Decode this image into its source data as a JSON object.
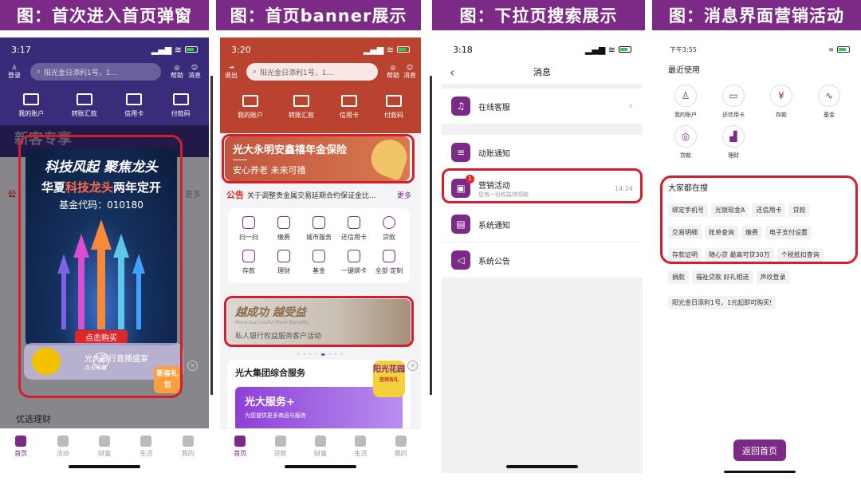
{
  "captions": [
    "图：首次进入首页弹窗",
    "图：首页banner展示",
    "图：下拉页搜索展示",
    "图：消息界面营销活动"
  ],
  "colors": {
    "brand": "#7b2a86",
    "highlight": "#d51e2b",
    "banner_red": "#c0392b"
  },
  "p1": {
    "time": "3:17",
    "search_placeholder": "阳光金日添利1号，1...",
    "left_icon_label": "登录",
    "right_labels": [
      "帮助",
      "消息"
    ],
    "quick": [
      "我的账户",
      "转账汇款",
      "信用卡",
      "付款码"
    ],
    "bg_title": "新客专享",
    "notice_short": "公",
    "more": "更多",
    "popup": {
      "line1": "科技风起 聚焦龙头",
      "line2a": "华夏",
      "line2b": "科技龙头",
      "line2c": "两年定开",
      "line3": "基金代码：010180",
      "button": "点击购买"
    },
    "bottom_banner": "光大银行直播盛宴",
    "bottom_sub": "点击观看",
    "side_badge": "新客礼包",
    "section": "优选理财",
    "tabs": [
      "首页",
      "活动",
      "财富",
      "生活",
      "我的"
    ]
  },
  "p2": {
    "time": "3:20",
    "left_label": "退出",
    "search_placeholder": "阳光金日添利1号，1...",
    "right_labels": [
      "帮助",
      "消息"
    ],
    "quick": [
      "我的账户",
      "转账汇款",
      "信用卡",
      "付款码"
    ],
    "banner": {
      "title": "光大永明安鑫禧年金保险",
      "sub": "安心养老 未来可禧"
    },
    "notice_tag": "公告",
    "notice": "关于调整贵金属交易延期合约保证金比...",
    "more": "更多",
    "grid": [
      "扫一扫",
      "缴费",
      "城市服务",
      "还信用卡",
      "贷款",
      "存款",
      "理财",
      "基金",
      "一键绑卡",
      "全部·定制"
    ],
    "banner2": {
      "title": "越成功 越受益",
      "en": "More Successful More Benefits",
      "sub": "私人银行权益服务客户活动"
    },
    "card_title": "光大集团综合服务",
    "card_inner": "光大服务+",
    "card_inner_sub": "为您提供更多商品与服务",
    "badge": "阳光花园",
    "badge_sub": "签到有礼",
    "tabs": [
      "首页",
      "贷款",
      "财富",
      "生活",
      "我的"
    ]
  },
  "p3": {
    "time": "3:18",
    "title": "消息",
    "rows": [
      {
        "icon": "headset-icon",
        "label": "在线客服",
        "arrow": "›"
      },
      {
        "icon": "bell-icon",
        "label": "动账通知"
      },
      {
        "icon": "gift-icon",
        "label": "营销活动",
        "sub": "您有一份权益待领取",
        "time": "14:24",
        "badge": "1"
      },
      {
        "icon": "doc-icon",
        "label": "系统通知"
      },
      {
        "icon": "speaker-icon",
        "label": "系统公告"
      }
    ]
  },
  "p4": {
    "time": "下午3:55",
    "status_right": "",
    "recent_title": "最近使用",
    "recent": [
      "我的账户",
      "还信用卡",
      "存款",
      "基金",
      "贷款",
      "理财"
    ],
    "hot_title": "大家都在搜",
    "tags_rows": [
      [
        "绑定手机号",
        "光银现金A",
        "还信用卡",
        "贷款"
      ],
      [
        "交易明细",
        "账单查询",
        "缴费",
        "电子支付设置"
      ],
      [
        "存款证明",
        "随心贷 最高可贷30万",
        "个税抵扣查询"
      ],
      [
        "捐款",
        "福祉贷款 好礼相送",
        "声纹登录"
      ]
    ],
    "extra_tag": "阳光金日添利1号，1元起即可购买!",
    "back_button": "返回首页"
  }
}
